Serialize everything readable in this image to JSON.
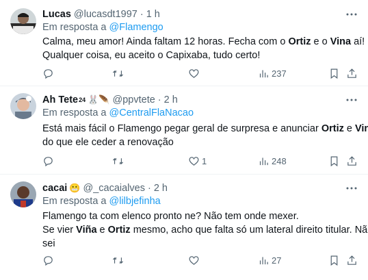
{
  "tweets": [
    {
      "name": "Lucas",
      "handle": "@lucasdt1997",
      "time": "1 h",
      "reply_prefix": "Em resposta a ",
      "reply_to": "@Flamengo",
      "text_parts": [
        [
          "Calma, meu amor! Ainda faltam 12 horas. Fecha com o ",
          "Ortiz",
          " e o ",
          "Vina",
          " aí!"
        ],
        [
          "Qualquer coisa, eu aceito o Capixaba, tudo certo!"
        ]
      ],
      "views": "237",
      "replies": "",
      "retweets": "",
      "likes": ""
    },
    {
      "name": "Ah Tete",
      "badge": "24",
      "emoji": "🐰🪶",
      "handle": "@ppvtete",
      "time": "2 h",
      "reply_prefix": "Em resposta a ",
      "reply_to": "@CentralFlaNacao",
      "text_parts": [
        [
          "Está mais fácil o Flamengo pegar geral de surpresa e anunciar ",
          "Ortiz",
          " e ",
          "Vina",
          ","
        ],
        [
          "do que ele ceder a renovação"
        ]
      ],
      "views": "248",
      "replies": "",
      "retweets": "",
      "likes": "1"
    },
    {
      "name": "cacai",
      "emoji": "😬",
      "handle": "@_cacaialves",
      "time": "2 h",
      "reply_prefix": "Em resposta a ",
      "reply_to": "@lilbjefinha",
      "text_parts": [
        [
          "Flamengo ta com elenco pronto ne? Não tem onde mexer."
        ],
        [
          "Se vier ",
          "Viña",
          " e ",
          "Ortiz",
          " mesmo, acho que falta só um lateral direito titular. Não"
        ],
        [
          "sei"
        ]
      ],
      "views": "27",
      "replies": "",
      "retweets": "",
      "likes": ""
    }
  ],
  "icons": {
    "more": "more-icon",
    "reply": "reply-icon",
    "retweet": "retweet-icon",
    "like": "heart-icon",
    "views": "views-icon",
    "bookmark": "bookmark-icon",
    "share": "share-icon"
  },
  "colors": {
    "link": "#1d9bf0",
    "muted": "#536471",
    "text": "#0f1419",
    "divider": "#eff3f4"
  }
}
